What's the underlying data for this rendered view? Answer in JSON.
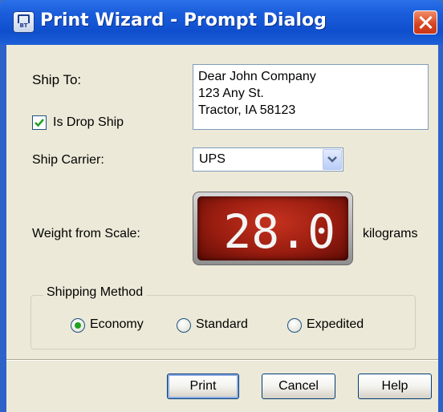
{
  "window": {
    "title": "Print Wizard - Prompt Dialog",
    "titlebar_color": "#0f4fce",
    "icon_label": "BT"
  },
  "ship_to": {
    "label": "Ship To:",
    "lines": [
      "Dear John Company",
      "123 Any St.",
      "Tractor, IA 58123"
    ]
  },
  "drop_ship": {
    "label": "Is Drop Ship",
    "checked": true
  },
  "ship_carrier": {
    "label": "Ship Carrier:",
    "value": "UPS"
  },
  "weight": {
    "label": "Weight from Scale:",
    "value": "28.0",
    "unit": "kilograms",
    "display_color": "#b3261a",
    "digit_color": "#f4f4f4"
  },
  "shipping_method": {
    "title": "Shipping Method",
    "options": [
      "Economy",
      "Standard",
      "Expedited"
    ],
    "selected": "Economy"
  },
  "buttons": {
    "print": "Print",
    "cancel": "Cancel",
    "help": "Help"
  }
}
